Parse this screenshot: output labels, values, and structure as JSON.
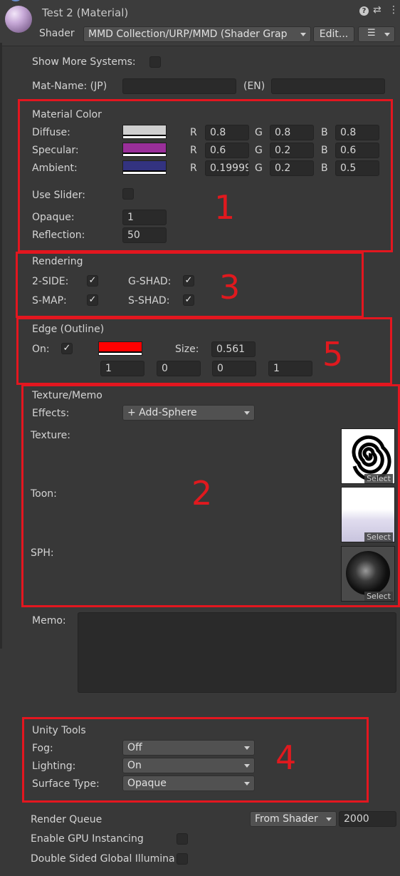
{
  "header": {
    "title": "Test 2 (Material)",
    "shader_label": "Shader",
    "shader_value": "MMD Collection/URP/MMD (Shader Grap",
    "edit_label": "Edit...",
    "icons": [
      "help-icon",
      "preset-icon",
      "kebab-icon",
      "list-icon"
    ]
  },
  "top": {
    "show_more_label": "Show More Systems:",
    "mat_name_label": "Mat-Name: (JP)",
    "en_label": "(EN)",
    "jp_value": "",
    "en_value": ""
  },
  "material_color": {
    "title": "Material Color",
    "rows": [
      {
        "label": "Diffuse:",
        "color": "#cfcfcf",
        "r": "0.8",
        "g": "0.8",
        "b": "0.8"
      },
      {
        "label": "Specular:",
        "color": "#9a2f9a",
        "r": "0.6",
        "g": "0.2",
        "b": "0.6"
      },
      {
        "label": "Ambient:",
        "color": "#333380",
        "r": "0.19999",
        "g": "0.2",
        "b": "0.5"
      }
    ],
    "channel_labels": {
      "r": "R",
      "g": "G",
      "b": "B"
    },
    "use_slider_label": "Use Slider:",
    "opaque_label": "Opaque:",
    "opaque_value": "1",
    "reflection_label": "Reflection:",
    "reflection_value": "50"
  },
  "rendering": {
    "title": "Rendering",
    "two_side_label": "2-SIDE:",
    "g_shad_label": "G-SHAD:",
    "s_map_label": "S-MAP:",
    "s_shad_label": "S-SHAD:",
    "check_mark": "✓"
  },
  "edge": {
    "title": "Edge (Outline)",
    "on_label": "On:",
    "color": "#ff0000",
    "size_label": "Size:",
    "size_value": "0.561",
    "rgba": [
      "1",
      "0",
      "0",
      "1"
    ]
  },
  "texture": {
    "title": "Texture/Memo",
    "effects_label": "Effects:",
    "effects_value": "+ Add-Sphere",
    "texture_label": "Texture:",
    "toon_label": "Toon:",
    "sph_label": "SPH:",
    "select_label": "Select",
    "memo_label": "Memo:",
    "memo_value": ""
  },
  "unity_tools": {
    "title": "Unity Tools",
    "fog_label": "Fog:",
    "fog_value": "Off",
    "lighting_label": "Lighting:",
    "lighting_value": "On",
    "surface_label": "Surface Type:",
    "surface_value": "Opaque"
  },
  "footer": {
    "render_queue_label": "Render Queue",
    "render_queue_mode": "From Shader",
    "render_queue_value": "2000",
    "gpu_instancing_label": "Enable GPU Instancing",
    "double_sided_label": "Double Sided Global Illumina"
  },
  "annotations": [
    "1",
    "3",
    "5",
    "2",
    "4"
  ],
  "colors": {
    "background": "#383838",
    "annotation_red": "#e3161f",
    "field_bg": "#2a2a2a"
  }
}
